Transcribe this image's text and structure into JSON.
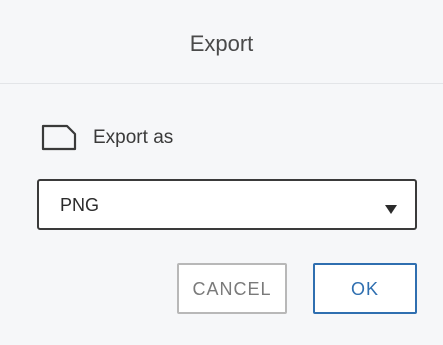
{
  "dialog": {
    "title": "Export",
    "export_label": "Export as",
    "file_icon": "file-icon",
    "format_select": {
      "selected": "PNG",
      "dropdown_icon": "triangle-down-icon"
    },
    "buttons": {
      "cancel_label": "CANCEL",
      "ok_label": "OK"
    }
  },
  "colors": {
    "primary": "#2f6fb0",
    "muted_border": "#b8b8b8",
    "header_bg": "#f6f7f9"
  }
}
